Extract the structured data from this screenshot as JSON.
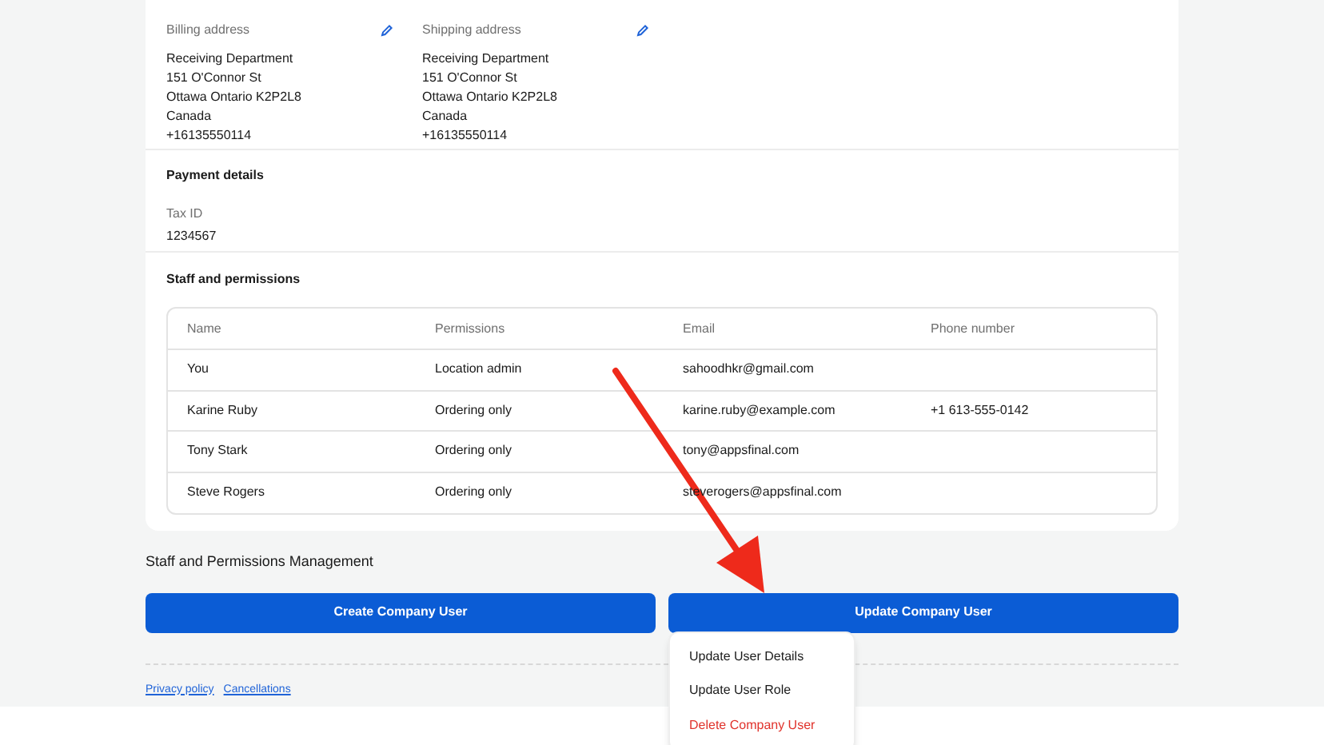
{
  "addresses": [
    {
      "title": "Billing address",
      "lines": [
        "Receiving Department",
        "151 O'Connor St",
        "Ottawa Ontario K2P2L8",
        "Canada",
        "+16135550114"
      ]
    },
    {
      "title": "Shipping address",
      "lines": [
        "Receiving Department",
        "151 O'Connor St",
        "Ottawa Ontario K2P2L8",
        "Canada",
        "+16135550114"
      ]
    }
  ],
  "payment": {
    "title": "Payment details",
    "label": "Tax ID",
    "value": "1234567"
  },
  "staff": {
    "title": "Staff and permissions",
    "columns": [
      "Name",
      "Permissions",
      "Email",
      "Phone number"
    ],
    "rows": [
      [
        "You",
        "Location admin",
        "sahoodhkr@gmail.com",
        ""
      ],
      [
        "Karine Ruby",
        "Ordering only",
        "karine.ruby@example.com",
        "+1 613-555-0142"
      ],
      [
        "Tony Stark",
        "Ordering only",
        "tony@appsfinal.com",
        ""
      ],
      [
        "Steve Rogers",
        "Ordering only",
        "steverogers@appsfinal.com",
        ""
      ]
    ]
  },
  "management": {
    "title": "Staff and Permissions Management",
    "buttons": [
      "Create Company User",
      "Update Company User"
    ],
    "menu": [
      {
        "label": "Update User Details",
        "kind": "normal"
      },
      {
        "label": "Update User Role",
        "kind": "normal"
      },
      {
        "label": "Delete Company User",
        "kind": "danger"
      }
    ]
  },
  "footer_links": [
    "Privacy policy",
    "Cancellations"
  ]
}
